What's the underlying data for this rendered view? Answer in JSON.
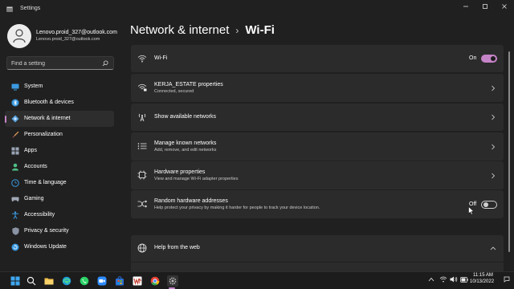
{
  "window": {
    "title": "Settings",
    "controls": [
      "minimize",
      "maximize",
      "close"
    ]
  },
  "profile": {
    "name": "Lenovo.proid_327@outlook.com",
    "email": "Lenovo.proid_327@outlook.com"
  },
  "search": {
    "placeholder": "Find a setting",
    "value": ""
  },
  "sidebar": {
    "items": [
      {
        "label": "System",
        "icon": "monitor-icon"
      },
      {
        "label": "Bluetooth & devices",
        "icon": "bluetooth-icon"
      },
      {
        "label": "Network & internet",
        "icon": "wifi-diamond-icon",
        "active": true
      },
      {
        "label": "Personalization",
        "icon": "brush-icon"
      },
      {
        "label": "Apps",
        "icon": "apps-icon"
      },
      {
        "label": "Accounts",
        "icon": "person-icon"
      },
      {
        "label": "Time & language",
        "icon": "globe-clock-icon"
      },
      {
        "label": "Gaming",
        "icon": "gamepad-icon"
      },
      {
        "label": "Accessibility",
        "icon": "accessibility-icon"
      },
      {
        "label": "Privacy & security",
        "icon": "shield-icon"
      },
      {
        "label": "Windows Update",
        "icon": "update-icon"
      }
    ]
  },
  "breadcrumb": {
    "parent": "Network & internet",
    "separator": "›",
    "current": "Wi-Fi"
  },
  "wifi_toggle": {
    "label": "Wi-Fi",
    "state": "On"
  },
  "network_properties": {
    "title": "KERJA_ESTATE properties",
    "subtitle": "Connected, secured"
  },
  "show_networks": {
    "title": "Show available networks"
  },
  "known_networks": {
    "title": "Manage known networks",
    "subtitle": "Add, remove, and edit networks"
  },
  "hardware_properties": {
    "title": "Hardware properties",
    "subtitle": "View and manage Wi-Fi adapter properties"
  },
  "random_addresses": {
    "title": "Random hardware addresses",
    "subtitle": "Help protect your privacy by making it harder for people to track your device location.",
    "state": "Off"
  },
  "help": {
    "title": "Help from the web"
  },
  "taskbar": {
    "apps": [
      "start-icon",
      "search-icon",
      "file-explorer-icon",
      "edge-icon",
      "whatsapp-icon",
      "zoom-icon",
      "store-icon",
      "word-icon",
      "chrome-icon",
      "photos-icon",
      "settings-gear-icon"
    ],
    "time": "11:15 AM",
    "date": "10/13/2022"
  },
  "colors": {
    "accent": "#c684c8",
    "background": "#202020",
    "card": "#2b2b2b"
  }
}
